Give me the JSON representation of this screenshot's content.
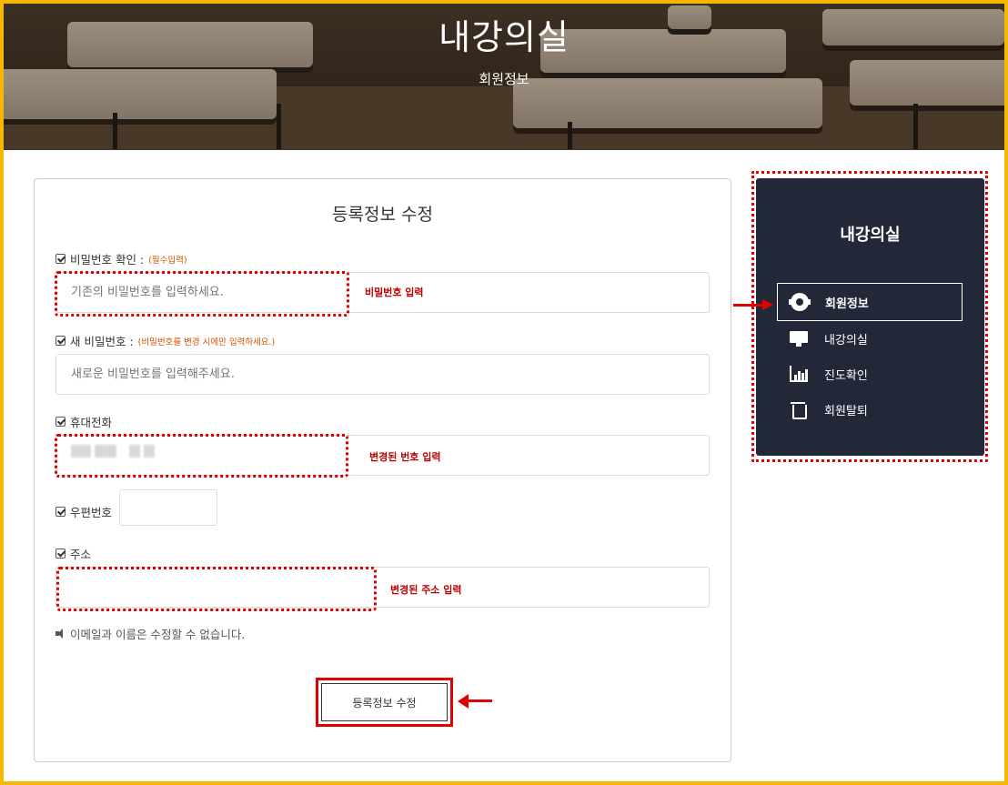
{
  "hero": {
    "title": "내강의실",
    "subtitle": "회원정보"
  },
  "form": {
    "title": "등록정보 수정",
    "fields": {
      "current_password": {
        "label": "비밀번호 확인 :",
        "note": "(필수입력)",
        "placeholder": "기존의 비밀번호를 입력하세요.",
        "annotation": "비밀번호 입력"
      },
      "new_password": {
        "label": "새 비밀번호 :",
        "note": "(비밀번호를 변경 시에만 입력하세요.)",
        "placeholder": "새로운 비밀번호를 입력해주세요."
      },
      "phone": {
        "label": "휴대전화",
        "annotation": "변경된 번호 입력"
      },
      "zipcode": {
        "label": "우편번호"
      },
      "address": {
        "label": "주소",
        "annotation": "변경된 주소 입력"
      }
    },
    "notice": "이메일과 이름은 수정할 수 없습니다.",
    "submit_label": "등록정보 수정"
  },
  "sidebar": {
    "title": "내강의실",
    "items": [
      {
        "label": "회원정보",
        "icon": "gear-icon",
        "active": true
      },
      {
        "label": "내강의실",
        "icon": "monitor-icon",
        "active": false
      },
      {
        "label": "진도확인",
        "icon": "bar-chart-icon",
        "active": false
      },
      {
        "label": "회원탈퇴",
        "icon": "trash-icon",
        "active": false
      }
    ]
  },
  "colors": {
    "frame": "#f5b800",
    "annotation_red": "#e00000",
    "sidebar_bg": "#232839",
    "note_orange": "#d35400"
  }
}
